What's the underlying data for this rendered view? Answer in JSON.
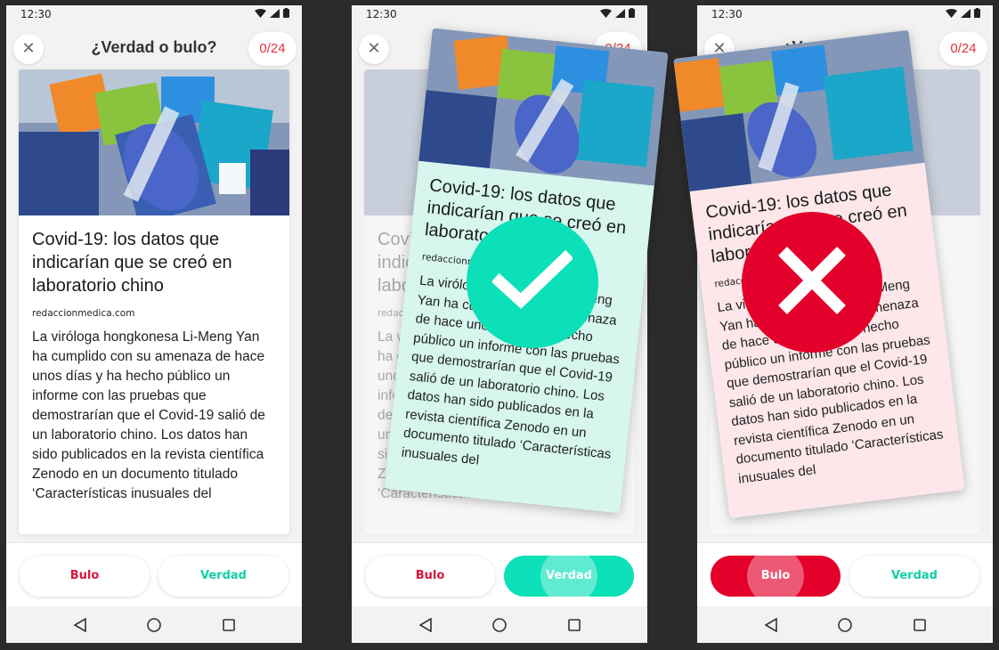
{
  "status": {
    "time": "12:30"
  },
  "header": {
    "title": "¿Verdad o bulo?",
    "counter": "0/24"
  },
  "article": {
    "headline": "Covid-19: los datos que indicarían que se creó en laboratorio chino",
    "source": "redaccionmedica.com",
    "body": "La viróloga hongkonesa Li-Meng Yan ha cumplido con su amenaza de hace unos días y ha hecho público un informe con las pruebas que demostrarían que el Covid-19 salió de un laboratorio chino. Los datos han sido publicados en la revista científica Zenodo en un documento titulado ‘Características inusuales del"
  },
  "buttons": {
    "bulo": "Bulo",
    "verdad": "Verdad"
  },
  "colors": {
    "bulo": "#e3002a",
    "verdad": "#0be0b8",
    "counter": "#e0333c"
  },
  "icons": [
    "close-icon",
    "wifi-icon",
    "signal-icon",
    "battery-icon",
    "check-icon",
    "cross-icon",
    "back-icon",
    "home-icon",
    "recents-icon"
  ]
}
